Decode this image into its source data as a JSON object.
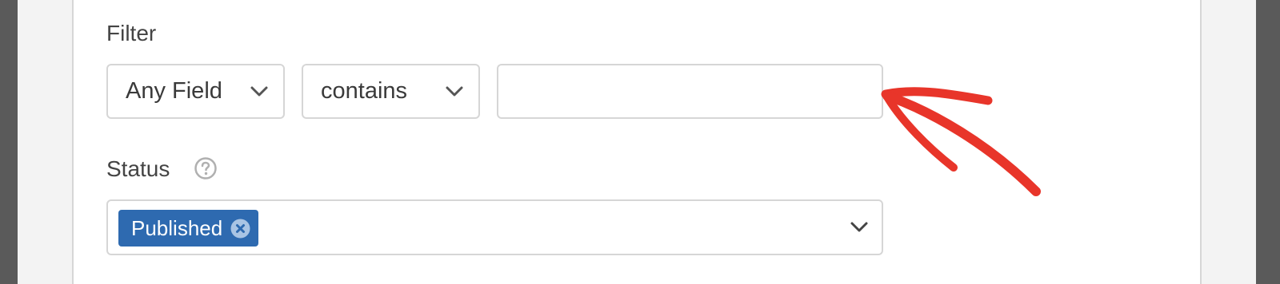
{
  "filter": {
    "label": "Filter",
    "field_select": {
      "selected": "Any Field"
    },
    "operator_select": {
      "selected": "contains"
    },
    "value_input": {
      "value": "",
      "placeholder": ""
    }
  },
  "status": {
    "label": "Status",
    "help_icon": "question-circle-icon",
    "selected_tags": [
      {
        "label": "Published"
      }
    ]
  },
  "colors": {
    "tag_background": "#2e6ab0",
    "annotation_arrow": "#e8352a",
    "border": "#d6d6d6",
    "text": "#444444"
  }
}
